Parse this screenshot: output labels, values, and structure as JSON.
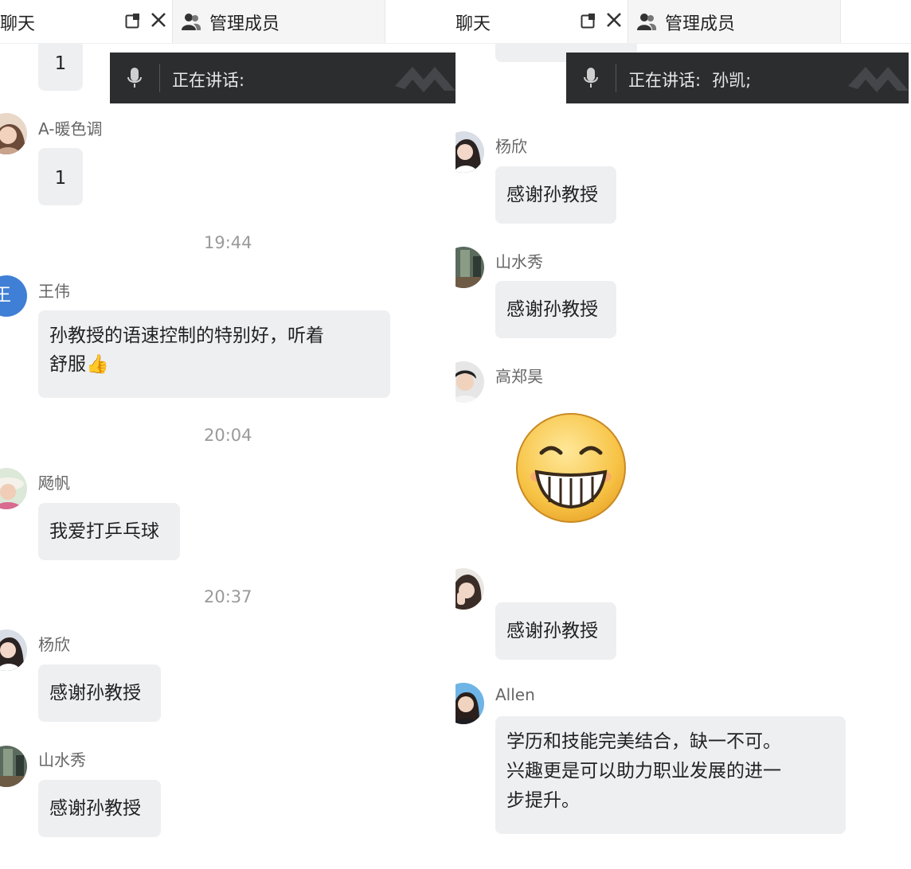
{
  "left": {
    "tab_chat": "聊天",
    "tab_members": "管理成员",
    "speaking_label": "正在讲话:",
    "speaking_name": "",
    "messages": [
      {
        "text": "1"
      },
      {
        "name": "A-暖色调",
        "text": "1"
      },
      {
        "time": "19:44"
      },
      {
        "name": "王伟",
        "avatar_text": "王伟",
        "text_line1": "孙教授的语速控制的特别好，听着",
        "text_line2": "舒服👍"
      },
      {
        "time": "20:04"
      },
      {
        "name": "飏帆",
        "text": "我爱打乒乓球"
      },
      {
        "time": "20:37"
      },
      {
        "name": "杨欣",
        "text": "感谢孙教授"
      },
      {
        "name": "山水秀",
        "text": "感谢孙教授"
      }
    ]
  },
  "right": {
    "tab_chat": "聊天",
    "tab_members": "管理成员",
    "speaking_label": "正在讲话:",
    "speaking_name": "孙凯;",
    "messages": [
      {
        "name": "杨欣",
        "text": "感谢孙教授"
      },
      {
        "name": "山水秀",
        "text": "感谢孙教授"
      },
      {
        "name": "高郑昊",
        "sticker": "grin-emoji"
      },
      {
        "name": "",
        "text": "感谢孙教授"
      },
      {
        "name": "Allen",
        "lines": [
          "学历和技能完美结合，缺一不可。",
          "兴趣更是可以助力职业发展的进一",
          "步提升。"
        ]
      }
    ]
  },
  "colors": {
    "bubble_bg": "#eeeff1",
    "speaking_bar_bg": "#2c2d2f",
    "avatar_blue": "#3f7fd6",
    "timestamp_gray": "#9a9a9a"
  },
  "icons": [
    "popout-icon",
    "close-icon",
    "members-icon",
    "mic-icon",
    "grin-emoji",
    "thumbs-up-emoji"
  ]
}
